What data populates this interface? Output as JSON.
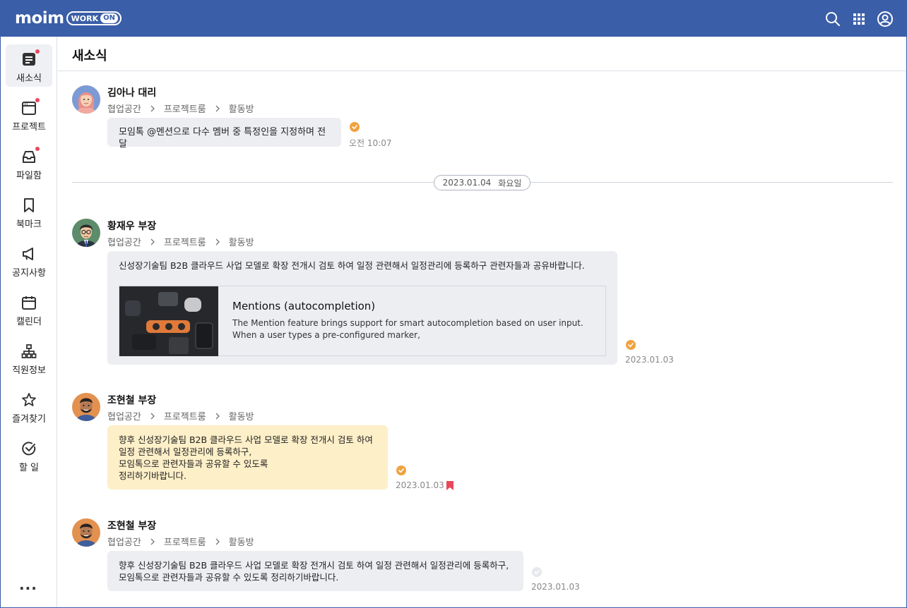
{
  "app": {
    "logo_text": "moim",
    "logo_badge": "WORK",
    "logo_badge_on": "ON"
  },
  "topbar": {
    "icons": [
      "search-icon",
      "apps-grid-icon",
      "user-account-icon"
    ]
  },
  "sidebar": {
    "items": [
      {
        "label": "새소식",
        "icon": "news-icon",
        "active": true,
        "dot": true
      },
      {
        "label": "프로젝트",
        "icon": "project-icon",
        "active": false,
        "dot": true
      },
      {
        "label": "파일함",
        "icon": "inbox-icon",
        "active": false,
        "dot": true
      },
      {
        "label": "북마크",
        "icon": "bookmark-icon",
        "active": false,
        "dot": false
      },
      {
        "label": "공지사항",
        "icon": "megaphone-icon",
        "active": false,
        "dot": false
      },
      {
        "label": "캘린더",
        "icon": "calendar-icon",
        "active": false,
        "dot": false
      },
      {
        "label": "직원정보",
        "icon": "org-chart-icon",
        "active": false,
        "dot": false
      },
      {
        "label": "즐겨찾기",
        "icon": "star-icon",
        "active": false,
        "dot": false
      },
      {
        "label": "할 일",
        "icon": "check-circle-icon",
        "active": false,
        "dot": false
      }
    ],
    "more_label": "..."
  },
  "page": {
    "title": "새소식"
  },
  "date_separator": {
    "date": "2023.01.04",
    "weekday": "화요일"
  },
  "messages": [
    {
      "sender": "김아나 대리",
      "crumbs": [
        "협업공간",
        "프로젝트룸",
        "활동방"
      ],
      "text": "모임톡 @멘션으로 다수 멤버 중 특정인을 지정하며  전달",
      "time": "오전 10:07",
      "read": true
    },
    {
      "sender": "황재우 부장",
      "crumbs": [
        "협업공간",
        "프로젝트룸",
        "활동방"
      ],
      "text": "신성장기술팀 B2B 클라우드 사업 모델로 확장 전개시 검토 하여 일정 관련해서 일정관리에 등록하구 관련자들과 공유바랍니다.",
      "link_title": "Mentions (autocompletion)",
      "link_desc": "The Mention feature brings support for smart autocompletion based on user input. When a user types a pre-configured marker,",
      "time": "2023.01.03",
      "read": true
    },
    {
      "sender": "조현철 부장",
      "crumbs": [
        "협업공간",
        "프로젝트룸",
        "활동방"
      ],
      "lines": [
        "향후 신성장기술팀 B2B 클라우드 사업 모델로 확장 전개시 검토 하여",
        "일정 관련해서 일정관리에 등록하구,",
        "모임톡으로 관련자들과 공유할 수 있도록",
        "정리하기바랍니다."
      ],
      "time": "2023.01.03",
      "read": true,
      "bookmarked": true
    },
    {
      "sender": "조현철 부장",
      "crumbs": [
        "협업공간",
        "프로젝트룸",
        "활동방"
      ],
      "lines": [
        "향후 신성장기술팀 B2B 클라우드 사업 모델로 확장 전개시 검토 하여 일정 관련해서 일정관리에 등록하구,",
        " 모임톡으로 관련자들과 공유할 수 있도록 정리하기바랍니다."
      ],
      "time": "2023.01.03",
      "read": false
    }
  ],
  "colors": {
    "brand": "#3a5ea8",
    "read_check": "#f0a23f",
    "unread_dot": "#e8475b",
    "highlight_bubble": "#fdefc8"
  }
}
